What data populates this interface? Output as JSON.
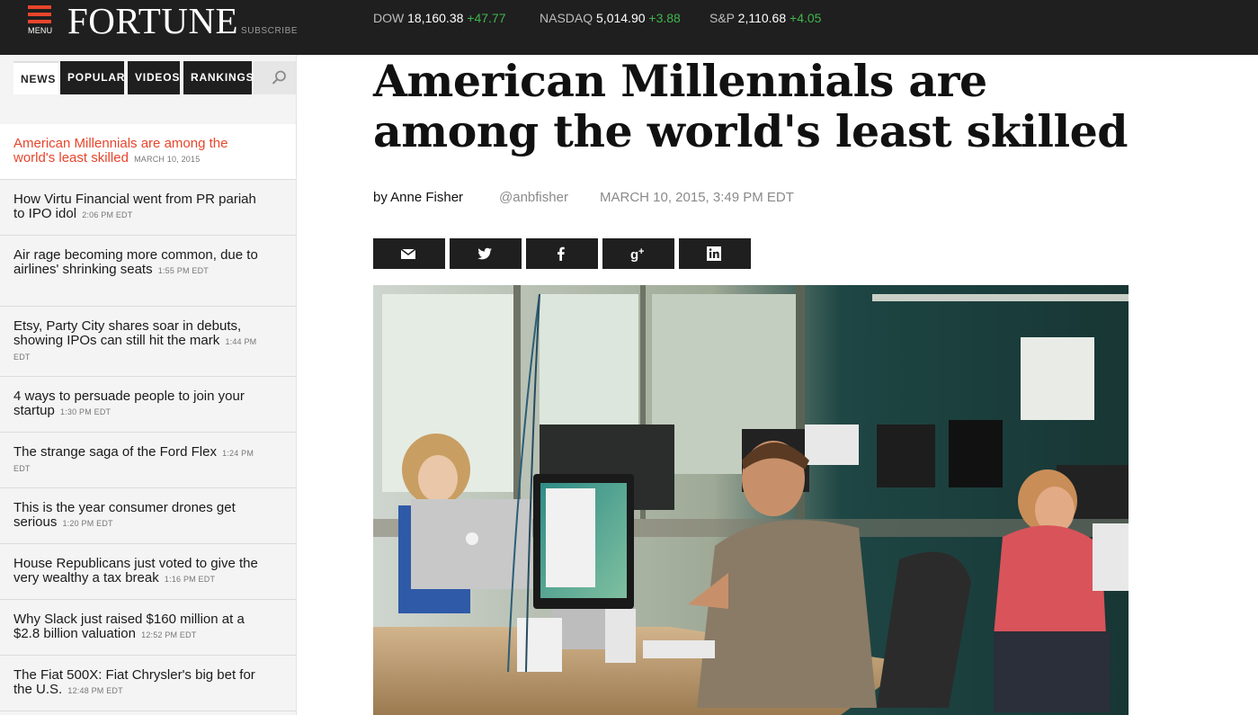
{
  "header": {
    "menu_label": "MENU",
    "logo": "FORTUNE",
    "subscribe": "SUBSCRIBE",
    "tickers": [
      {
        "name": "DOW",
        "value": "18,160.38",
        "change": "+47.77"
      },
      {
        "name": "NASDAQ",
        "value": "5,014.90",
        "change": "+3.88"
      },
      {
        "name": "S&P",
        "value": "2,110.68",
        "change": "+4.05"
      }
    ]
  },
  "sidebar": {
    "tabs": [
      "NEWS",
      "POPULAR",
      "VIDEOS",
      "RANKINGS"
    ],
    "active_tab": "NEWS",
    "search_icon": "search-icon",
    "stories": [
      {
        "title": "American Millennials are among the world's least skilled",
        "time": "MARCH 10, 2015"
      },
      {
        "title": "How Virtu Financial went from PR pariah to IPO idol",
        "time": "2:06 PM EDT"
      },
      {
        "title": "Air rage becoming more common, due to airlines' shrinking seats",
        "time": "1:55 PM EDT"
      },
      {
        "title": "Etsy, Party City shares soar in debuts, showing IPOs can still hit the mark",
        "time": "1:44 PM EDT"
      },
      {
        "title": "4 ways to persuade people to join your startup",
        "time": "1:30 PM EDT"
      },
      {
        "title": "The strange saga of the Ford Flex",
        "time": "1:24 PM EDT"
      },
      {
        "title": "This is the year consumer drones get serious",
        "time": "1:20 PM EDT"
      },
      {
        "title": "House Republicans just voted to give the very wealthy a tax break",
        "time": "1:16 PM EDT"
      },
      {
        "title": "Why Slack just raised $160 million at a $2.8 billion valuation",
        "time": "12:52 PM EDT"
      },
      {
        "title": "The Fiat 500X: Fiat Chrysler's big bet for the U.S.",
        "time": "12:48 PM EDT"
      }
    ]
  },
  "article": {
    "headline": "American Millennials are among the world's least skilled",
    "author": "by Anne Fisher",
    "handle": "@anbfisher",
    "date": "MARCH 10, 2015, 3:49 PM EDT",
    "share_icons": [
      "email-icon",
      "twitter-icon",
      "facebook-icon",
      "google-plus-icon",
      "linkedin-icon"
    ]
  },
  "colors": {
    "brand_red": "#e8452c",
    "ticker_green": "#3fb44d",
    "bar_dark": "#1f1f1f"
  }
}
